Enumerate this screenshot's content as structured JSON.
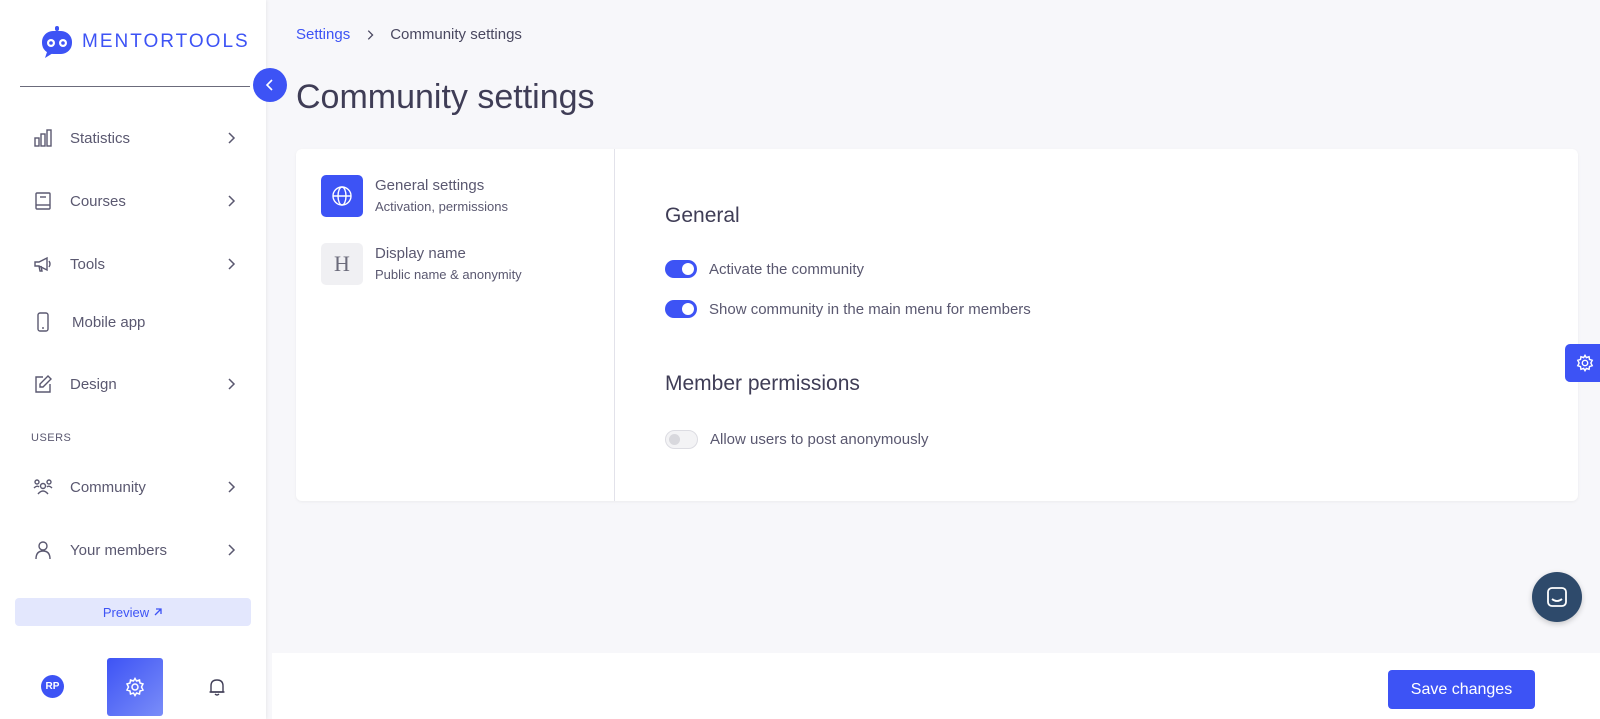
{
  "brand": {
    "name": "MENTORTOOLS",
    "accent": "#3d53f5"
  },
  "sidebar": {
    "items": [
      {
        "label": "Statistics",
        "icon": "bar-chart-icon",
        "has_chevron": true
      },
      {
        "label": "Courses",
        "icon": "book-icon",
        "has_chevron": true
      },
      {
        "label": "Tools",
        "icon": "megaphone-icon",
        "has_chevron": true
      },
      {
        "label": "Mobile app",
        "icon": "smartphone-icon",
        "has_chevron": false
      },
      {
        "label": "Design",
        "icon": "pencil-icon",
        "has_chevron": true
      }
    ],
    "users_section_label": "USERS",
    "user_items": [
      {
        "label": "Community",
        "icon": "users-icon",
        "has_chevron": true
      },
      {
        "label": "Your members",
        "icon": "user-icon",
        "has_chevron": true
      }
    ],
    "preview_label": "Preview",
    "avatar_initials": "RP"
  },
  "breadcrumb": {
    "parent": "Settings",
    "current": "Community settings"
  },
  "page_title": "Community settings",
  "submenu": [
    {
      "title": "General settings",
      "desc": "Activation, permissions",
      "icon": "globe-icon",
      "active": true
    },
    {
      "title": "Display name",
      "desc": "Public name & anonymity",
      "icon_glyph": "H",
      "active": false
    }
  ],
  "general": {
    "heading": "General",
    "toggles": [
      {
        "label": "Activate the community",
        "on": true
      },
      {
        "label": "Show community in the main menu for members",
        "on": true
      }
    ]
  },
  "permissions": {
    "heading": "Member permissions",
    "toggles": [
      {
        "label": "Allow users to post anonymously",
        "on": false
      }
    ]
  },
  "footer": {
    "save_label": "Save changes"
  }
}
